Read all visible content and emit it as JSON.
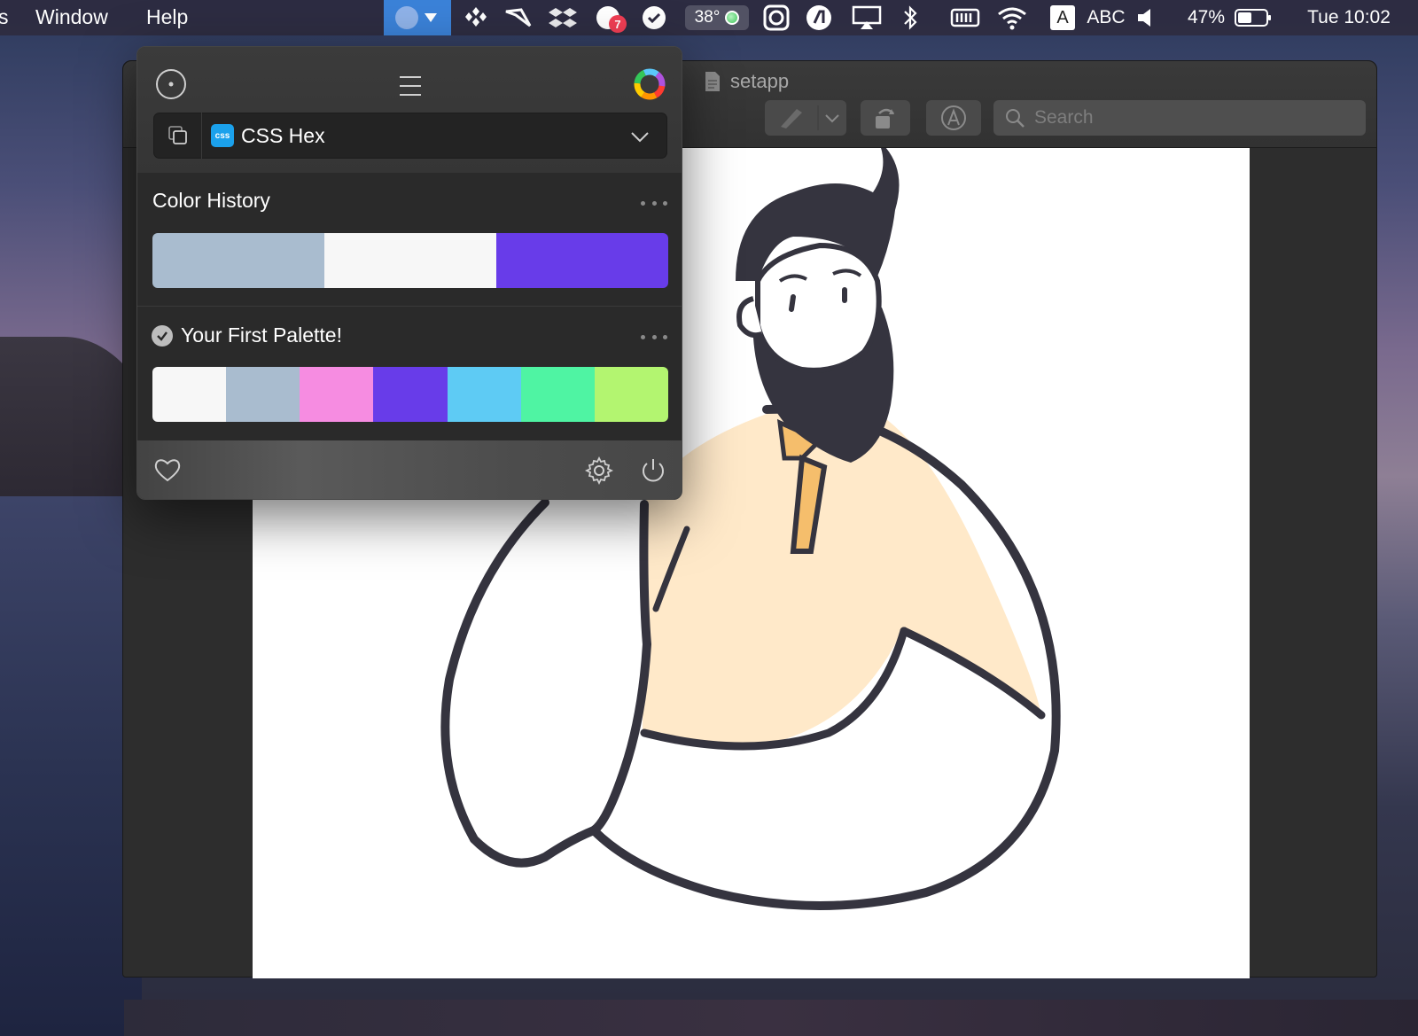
{
  "menubar": {
    "items": [
      "s",
      "Window",
      "Help"
    ],
    "weather_temp": "38°",
    "notification_count": "7",
    "input_letter": "A",
    "input_source": "ABC",
    "battery_percent": "47%",
    "clock": "Tue 10:02",
    "accent_color": "#3b82d8"
  },
  "window": {
    "title": "setapp",
    "search_placeholder": "Search",
    "icons": [
      "document-icon",
      "markup-pen-icon",
      "chevron-down-icon",
      "rotate-icon",
      "annotate-icon",
      "search-icon"
    ]
  },
  "picker": {
    "format": {
      "badge": "css",
      "label": "CSS Hex"
    },
    "history": {
      "title": "Color History",
      "colors": [
        "#a9bccf",
        "#f7f7f7",
        "#683ce9"
      ]
    },
    "palette": {
      "title": "Your First Palette!",
      "colors": [
        "#f7f7f7",
        "#a9bccf",
        "#f68ce1",
        "#683ce9",
        "#5ecbf4",
        "#4ff4a3",
        "#b3f570"
      ]
    },
    "icons": [
      "eyedropper-target-icon",
      "hamburger-menu-icon",
      "color-wheel-icon",
      "copy-icon",
      "chevron-down-icon",
      "more-icon",
      "checkmark-icon",
      "heart-icon",
      "gear-icon",
      "power-icon"
    ]
  },
  "illustration": {
    "colors": {
      "outline": "#35343f",
      "shirt": "#ffe9c9",
      "collar": "#f5be6c",
      "hair": "#35343f"
    }
  }
}
